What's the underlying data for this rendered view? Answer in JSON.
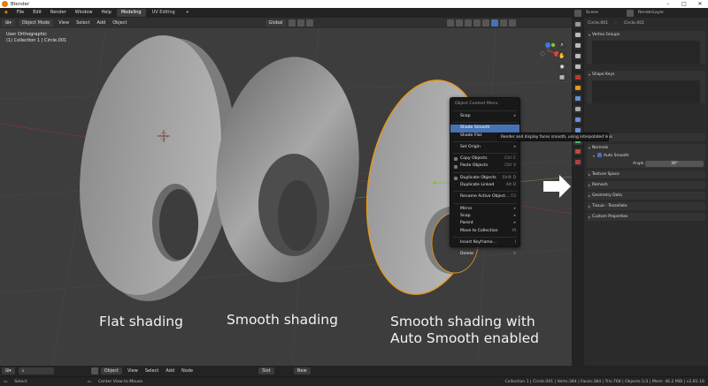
{
  "window": {
    "title": "Blender"
  },
  "menubar": {
    "menus": [
      "File",
      "Edit",
      "Render",
      "Window",
      "Help"
    ],
    "workspaces": [
      "Modeling",
      "UV Editing"
    ],
    "add_workspace": "+"
  },
  "viewport_header": {
    "mode": "Object Mode",
    "menus": [
      "View",
      "Select",
      "Add",
      "Object"
    ],
    "orientation": "Global"
  },
  "viewport": {
    "view_name": "User Orthographic",
    "collection_info": "(1) Collection 1 | Circle.001"
  },
  "captions": {
    "flat": "Flat shading",
    "smooth": "Smooth shading",
    "auto_line1": "Smooth shading with",
    "auto_line2": "Auto Smooth enabled"
  },
  "context_menu": {
    "title": "Object Context Menu",
    "items": [
      {
        "label": "Snap",
        "shortcut": ""
      },
      {
        "label": "Shade Smooth",
        "shortcut": ""
      },
      {
        "label": "Shade Flat",
        "shortcut": ""
      },
      {
        "label": "Set Origin",
        "shortcut": ""
      },
      {
        "label": "Copy Objects",
        "shortcut": "Ctrl C"
      },
      {
        "label": "Paste Objects",
        "shortcut": "Ctrl V"
      },
      {
        "label": "Duplicate Objects",
        "shortcut": "Shift D"
      },
      {
        "label": "Duplicate Linked",
        "shortcut": "Alt D"
      },
      {
        "label": "Rename Active Object...",
        "shortcut": "F2"
      },
      {
        "label": "Mirror",
        "shortcut": ""
      },
      {
        "label": "Snap",
        "shortcut": ""
      },
      {
        "label": "Parent",
        "shortcut": ""
      },
      {
        "label": "Move to Collection",
        "shortcut": "M"
      },
      {
        "label": "Insert Keyframe...",
        "shortcut": "I"
      },
      {
        "label": "Delete",
        "shortcut": "X"
      }
    ]
  },
  "tooltip": "Render and display faces smooth, using interpolated Vertex Normals.",
  "top_right": {
    "scene_label": "Scene",
    "view_layer_label": "RenderLayer"
  },
  "properties": {
    "object_name": "Circle.001",
    "mesh_name": "Circle.001",
    "vertex_groups": "Vertex Groups",
    "shape_keys": "Shape Keys",
    "face_maps": "Face Maps",
    "normals": "Normals",
    "auto_smooth": "Auto Smooth",
    "angle_label": "Angle",
    "angle_value": "30°",
    "texture_space": "Texture Space",
    "remesh": "Remesh",
    "geometry_data": "Geometry Data",
    "viewport_display": "Tissue - Tessellate",
    "custom_properties": "Custom Properties"
  },
  "viewport_bottom": {
    "editor_menus": [
      "View",
      "Select",
      "Add",
      "Node"
    ],
    "object_label": "Object",
    "slot": "Slot",
    "new_button": "New"
  },
  "status_bar": {
    "left": "Select",
    "middle": "Center View to Mouse",
    "stats": "Collection 1 | Circle.001 | Verts:384 | Faces:384 | Tris:768 | Objects:1/3 | Mem: 46.2 MiB | v2.81.16"
  },
  "colors": {
    "accent_blue": "#4772b3",
    "selection_orange": "#e8981a",
    "viewport_bg": "#3d3d3d"
  }
}
